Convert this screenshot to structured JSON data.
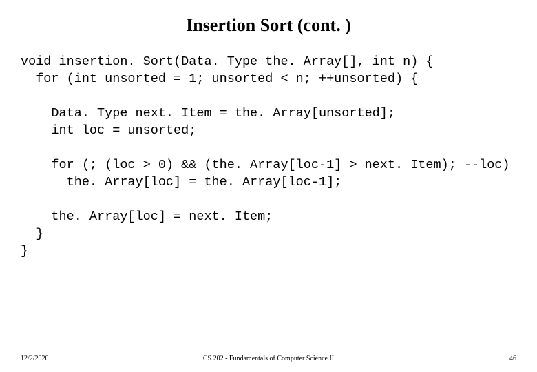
{
  "slide": {
    "title": "Insertion Sort (cont. )",
    "code": "void insertion. Sort(Data. Type the. Array[], int n) {\n  for (int unsorted = 1; unsorted < n; ++unsorted) {\n\n    Data. Type next. Item = the. Array[unsorted];\n    int loc = unsorted;\n\n    for (; (loc > 0) && (the. Array[loc-1] > next. Item); --loc)\n      the. Array[loc] = the. Array[loc-1];\n\n    the. Array[loc] = next. Item;\n  }\n}"
  },
  "footer": {
    "date": "12/2/2020",
    "course": "CS 202 - Fundamentals of Computer Science II",
    "page": "46"
  }
}
